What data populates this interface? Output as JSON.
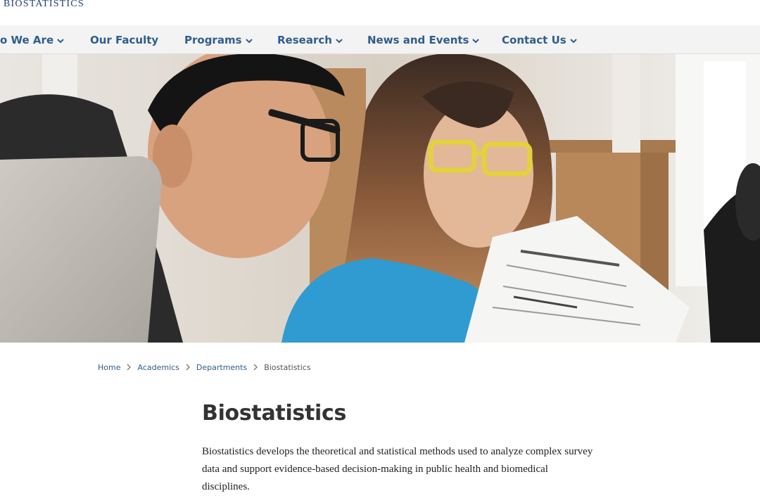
{
  "brand": {
    "name": "BIOSTATISTICS"
  },
  "nav": {
    "items": [
      {
        "label": "o We Are",
        "has_dropdown": true
      },
      {
        "label": "Our Faculty",
        "has_dropdown": false
      },
      {
        "label": "Programs",
        "has_dropdown": true
      },
      {
        "label": "Research",
        "has_dropdown": true
      },
      {
        "label": "News and Events",
        "has_dropdown": true
      },
      {
        "label": "Contact Us",
        "has_dropdown": true
      }
    ]
  },
  "hero": {
    "icon": "students-studying-photo"
  },
  "breadcrumb": {
    "items": [
      {
        "label": "Home",
        "link": true
      },
      {
        "label": "Academics",
        "link": true
      },
      {
        "label": "Departments",
        "link": true
      },
      {
        "label": "Biostatistics",
        "link": false
      }
    ]
  },
  "page": {
    "title": "Biostatistics",
    "intro": "Biostatistics develops the theoretical and statistical methods used to analyze complex survey data and support evidence-based decision-making in public health and biomedical disciplines."
  },
  "colors": {
    "nav_text": "#2f5d8a",
    "brand": "#1f3f7a",
    "nav_bg": "#f3f3f3"
  }
}
